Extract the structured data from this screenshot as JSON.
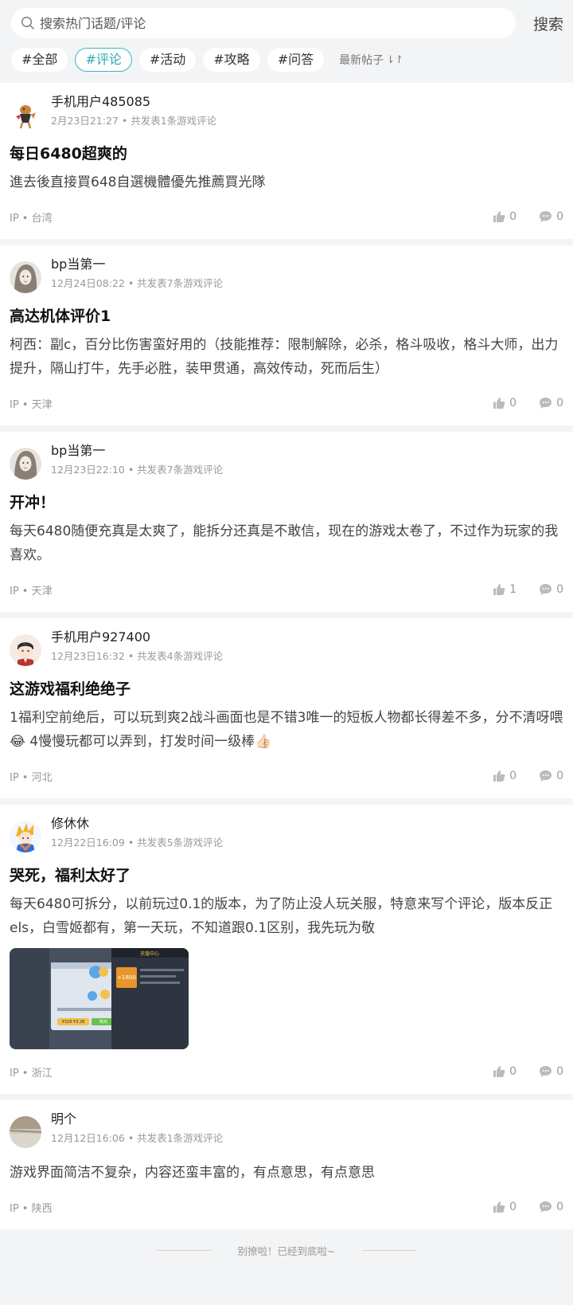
{
  "search": {
    "placeholder": "搜索热门话题/评论",
    "button": "搜索"
  },
  "filters": [
    {
      "label": "#全部",
      "active": false
    },
    {
      "label": "#评论",
      "active": true
    },
    {
      "label": "#活动",
      "active": false
    },
    {
      "label": "#攻略",
      "active": false
    },
    {
      "label": "#问答",
      "active": false
    }
  ],
  "sort_label": "最新帖子",
  "posts": [
    {
      "author": "手机用户485085",
      "date": "2月23日21:27",
      "meta": "共发表1条游戏评论",
      "title": "每日6480超爽的",
      "body": "進去後直接買648自選機體優先推薦買光隊",
      "ip": "IP • 台湾",
      "likes": "0",
      "comments": "0"
    },
    {
      "author": "bp当第一",
      "date": "12月24日08:22",
      "meta": "共发表7条游戏评论",
      "title": "高达机体评价1",
      "body": "柯西：副c，百分比伤害蛮好用的（技能推荐：限制解除，必杀，格斗吸收，格斗大师，出力提升，隔山打牛，先手必胜，装甲贯通，高效传动，死而后生）",
      "ip": "IP • 天津",
      "likes": "0",
      "comments": "0"
    },
    {
      "author": "bp当第一",
      "date": "12月23日22:10",
      "meta": "共发表7条游戏评论",
      "title": "开冲！",
      "body": "每天6480随便充真是太爽了，能拆分还真是不敢信，现在的游戏太卷了，不过作为玩家的我喜欢。",
      "ip": "IP • 天津",
      "likes": "1",
      "comments": "0"
    },
    {
      "author": "手机用户927400",
      "date": "12月23日16:32",
      "meta": "共发表4条游戏评论",
      "title": "这游戏福利绝绝子",
      "body": "1福利空前绝后，可以玩到爽2战斗画面也是不错3唯一的短板人物都长得差不多，分不清呀喂😂 4慢慢玩都可以弄到，打发时间一级棒👍🏻",
      "ip": "IP • 河北",
      "likes": "0",
      "comments": "0"
    },
    {
      "author": "修休休",
      "date": "12月22日16:09",
      "meta": "共发表5条游戏评论",
      "title": "哭死，福利太好了",
      "body": "每天6480可拆分，以前玩过0.1的版本，为了防止没人玩关服，特意来写个评论，版本反正els，白雪姬都有，第一天玩，不知道跟0.1区别，我先玩为敬",
      "ip": "IP • 浙江",
      "likes": "0",
      "comments": "0",
      "image": {
        "dialog_title": "充值中心",
        "amount": "+1800",
        "price": "¥328  ¥3.28",
        "buy": "购买"
      }
    },
    {
      "author": "明个",
      "date": "12月12日16:06",
      "meta": "共发表1条游戏评论",
      "title": "",
      "body": "游戏界面简洁不复杂，内容还蛮丰富的，有点意思，有点意思",
      "ip": "IP • 陕西",
      "likes": "0",
      "comments": "0"
    }
  ],
  "end_text": "别撩啦！已经到底啦~",
  "colors": {
    "accent": "#29a9b6",
    "background": "#f3f4f6"
  }
}
